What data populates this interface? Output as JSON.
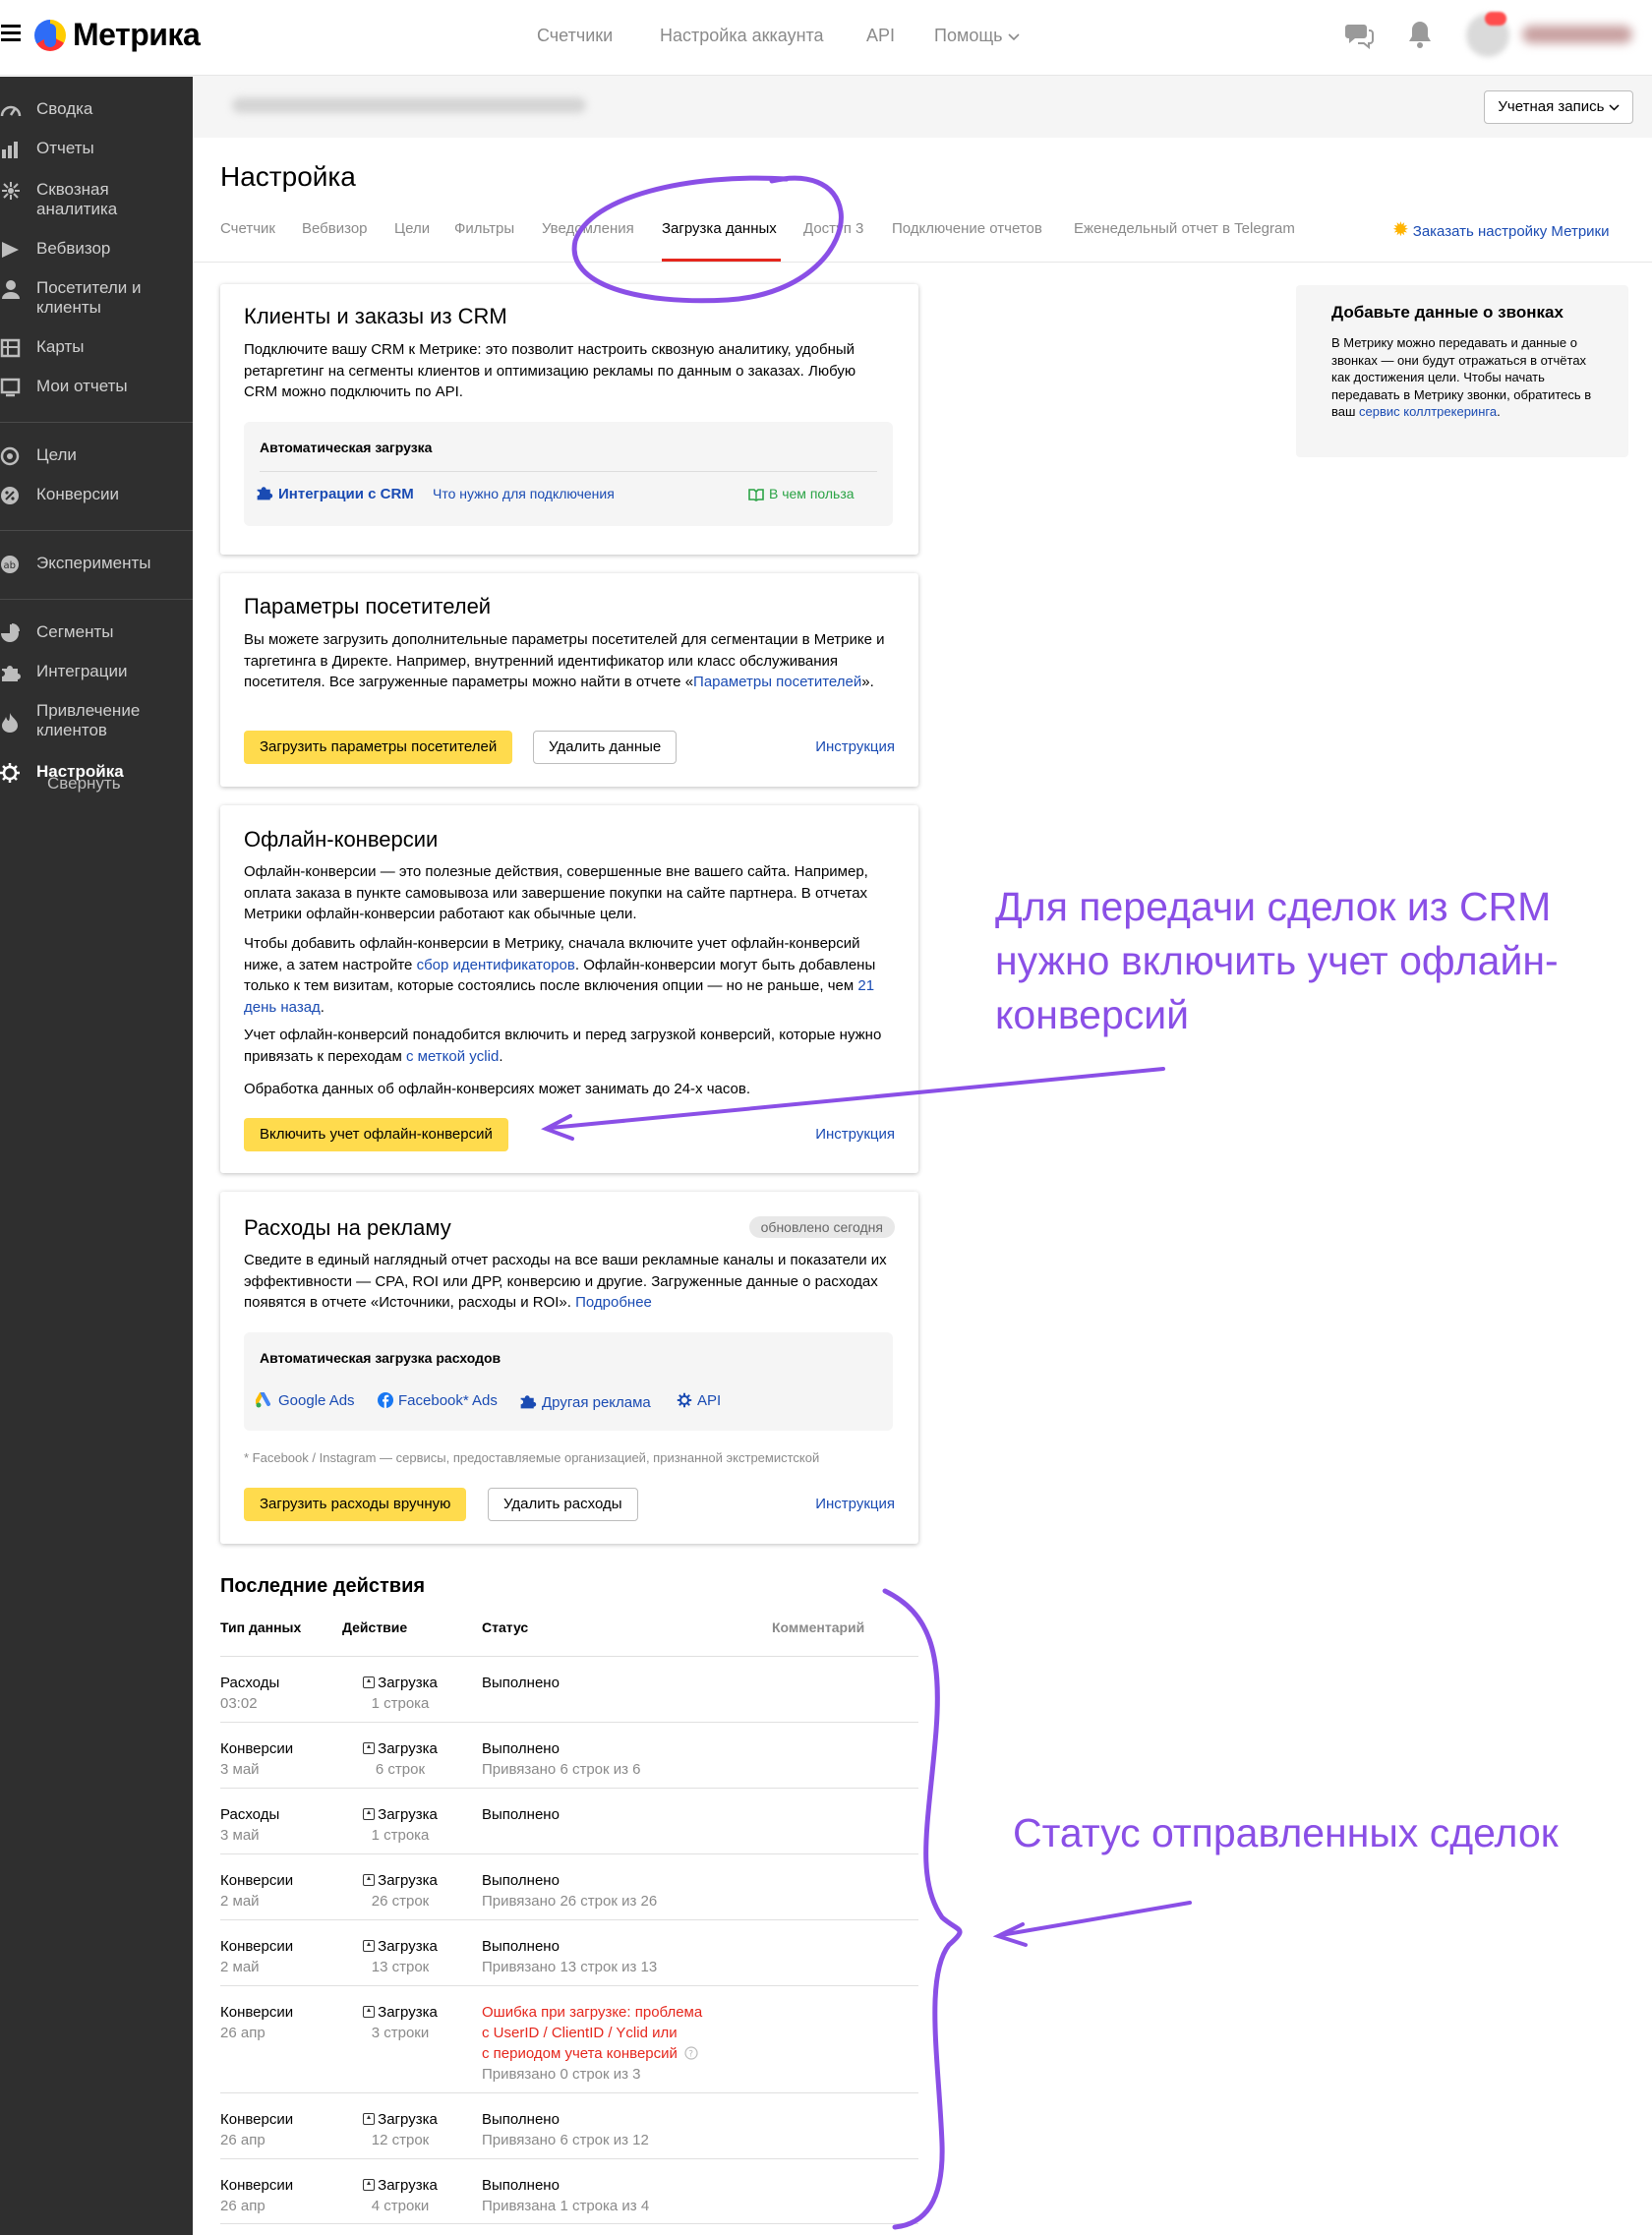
{
  "header": {
    "logo": "Метрика",
    "nav": [
      "Счетчики",
      "Настройка аккаунта",
      "API",
      "Помощь"
    ],
    "account_button": "Учетная запись"
  },
  "sidebar": {
    "items": [
      {
        "label": "Сводка",
        "icon": "dashboard-icon"
      },
      {
        "label": "Отчеты",
        "icon": "bar-chart-icon"
      },
      {
        "label": "Сквозная аналитика",
        "icon": "analytics-icon"
      },
      {
        "label": "Вебвизор",
        "icon": "play-icon"
      },
      {
        "label": "Посетители и клиенты",
        "icon": "person-icon"
      },
      {
        "label": "Карты",
        "icon": "map-icon"
      },
      {
        "label": "Мои отчеты",
        "icon": "my-reports-icon"
      },
      {
        "label": "Цели",
        "icon": "target-icon"
      },
      {
        "label": "Конверсии",
        "icon": "percent-icon"
      },
      {
        "label": "Эксперименты",
        "icon": "ab-icon"
      },
      {
        "label": "Сегменты",
        "icon": "pie-icon"
      },
      {
        "label": "Интеграции",
        "icon": "puzzle-icon"
      },
      {
        "label": "Привлечение клиентов",
        "icon": "flame-icon"
      },
      {
        "label": "Настройка",
        "icon": "gear-icon"
      }
    ],
    "collapse": "Свернуть"
  },
  "page": {
    "title": "Настройка",
    "tabs": [
      "Счетчик",
      "Вебвизор",
      "Цели",
      "Фильтры",
      "Уведомления",
      "Загрузка данных",
      "Доступ 3",
      "Подключение отчетов",
      "Еженедельный отчет в Telegram"
    ],
    "active_tab": "Загрузка данных",
    "order_setup": "Заказать настройку Метрики"
  },
  "crm": {
    "title": "Клиенты и заказы из CRM",
    "text": "Подключите вашу CRM к Метрике: это позволит настроить сквозную аналитику, удобный ретаргетинг на сегменты клиентов и оптимизацию рекламы по данным о заказах. Любую CRM можно подключить по API.",
    "auto_header": "Автоматическая загрузка",
    "integrations": "Интеграции с CRM",
    "requirements": "Что нужно для подключения",
    "benefit": "В чем польза"
  },
  "visitor_params": {
    "title": "Параметры посетителей",
    "text_before": "Вы можете загрузить дополнительные параметры посетителей для сегментации в Метрике и таргетинга в Директе. Например, внутренний идентификатор или класс обслуживания посетителя. Все загруженные параметры можно найти в отчете «",
    "text_link": "Параметры посетителей",
    "text_after": "».",
    "upload_button": "Загрузить параметры посетителей",
    "delete_button": "Удалить данные",
    "instruction": "Инструкция"
  },
  "offline": {
    "title": "Офлайн-конверсии",
    "p1": "Офлайн-конверсии — это полезные действия, совершенные вне вашего сайта. Например, оплата заказа в пункте самовывоза или завершение покупки на сайте партнера. В отчетах Метрики офлайн-конверсии работают как обычные цели.",
    "p2_a": "Чтобы добавить офлайн-конверсии в Метрику, сначала включите учет офлайн-конверсий ниже, а затем настройте ",
    "p2_link1": "сбор идентификаторов",
    "p2_b": ". Офлайн-конверсии могут быть добавлены только к тем визитам, которые состоялись после включения опции — но не раньше, чем ",
    "p2_link2": "21 день назад",
    "p2_c": ".",
    "p3_a": "Учет офлайн-конверсий понадобится включить и перед загрузкой конверсий, которые нужно привязать к переходам ",
    "p3_link": "с меткой yclid",
    "p3_b": ".",
    "p4": "Обработка данных об офлайн-конверсиях может занимать до 24-х часов.",
    "enable_button": "Включить учет офлайн-конверсий",
    "instruction": "Инструкция"
  },
  "ads": {
    "title": "Расходы на рекламу",
    "badge": "обновлено сегодня",
    "text_a": "Сведите в единый наглядный отчет расходы на все ваши рекламные каналы и показатели их эффективности — CPA, ROI или ДРР, конверсию и другие. Загруженные данные о расходах появятся в отчете «Источники, расходы и ROI». ",
    "text_link": "Подробнее",
    "auto_header": "Автоматическая загрузка расходов",
    "sources": [
      "Google Ads",
      "Facebook* Ads",
      "Другая реклама",
      "API"
    ],
    "footnote": "* Facebook / Instagram — сервисы, предоставляемые организацией, признанной экстремистской",
    "upload_button": "Загрузить расходы вручную",
    "delete_button": "Удалить расходы",
    "instruction": "Инструкция"
  },
  "calls": {
    "title": "Добавьте данные о звонках",
    "text": "В Метрику можно передавать и данные о звонках — они будут отражаться в отчётах как достижения цели. Чтобы начать передавать в Метрику звонки, обратитесь в ваш ",
    "link": "сервис коллтрекеринга",
    "end": "."
  },
  "recent": {
    "title": "Последние действия",
    "columns": [
      "Тип данных",
      "Действие",
      "Статус",
      "Комментарий"
    ],
    "rows": [
      {
        "type": "Расходы",
        "date": "03:02",
        "action": "Загрузка",
        "count": "1 строка",
        "status": "Выполнено",
        "detail": ""
      },
      {
        "type": "Конверсии",
        "date": "3 май",
        "action": "Загрузка",
        "count": "6 строк",
        "status": "Выполнено",
        "detail": "Привязано 6 строк из 6"
      },
      {
        "type": "Расходы",
        "date": "3 май",
        "action": "Загрузка",
        "count": "1 строка",
        "status": "Выполнено",
        "detail": ""
      },
      {
        "type": "Конверсии",
        "date": "2 май",
        "action": "Загрузка",
        "count": "26 строк",
        "status": "Выполнено",
        "detail": "Привязано 26 строк из 26"
      },
      {
        "type": "Конверсии",
        "date": "2 май",
        "action": "Загрузка",
        "count": "13 строк",
        "status": "Выполнено",
        "detail": "Привязано 13 строк из 13"
      },
      {
        "type": "Конверсии",
        "date": "26 апр",
        "action": "Загрузка",
        "count": "3 строки",
        "status_error": [
          "Ошибка при загрузке: проблема",
          "с UserID / ClientID / Yclid или",
          "с периодом учета конверсий"
        ],
        "detail": "Привязано 0 строк из 3"
      },
      {
        "type": "Конверсии",
        "date": "26 апр",
        "action": "Загрузка",
        "count": "12 строк",
        "status": "Выполнено",
        "detail": "Привязано 6 строк из 12"
      },
      {
        "type": "Конверсии",
        "date": "26 апр",
        "action": "Загрузка",
        "count": "4 строки",
        "status": "Выполнено",
        "detail": "Привязана 1 строка из 4"
      }
    ]
  },
  "annotations": {
    "note1": "Для передачи сделок из CRM нужно включить учет офлайн-конверсий",
    "note2": "Статус отправленных сделок",
    "color": "#8a4fe6"
  }
}
